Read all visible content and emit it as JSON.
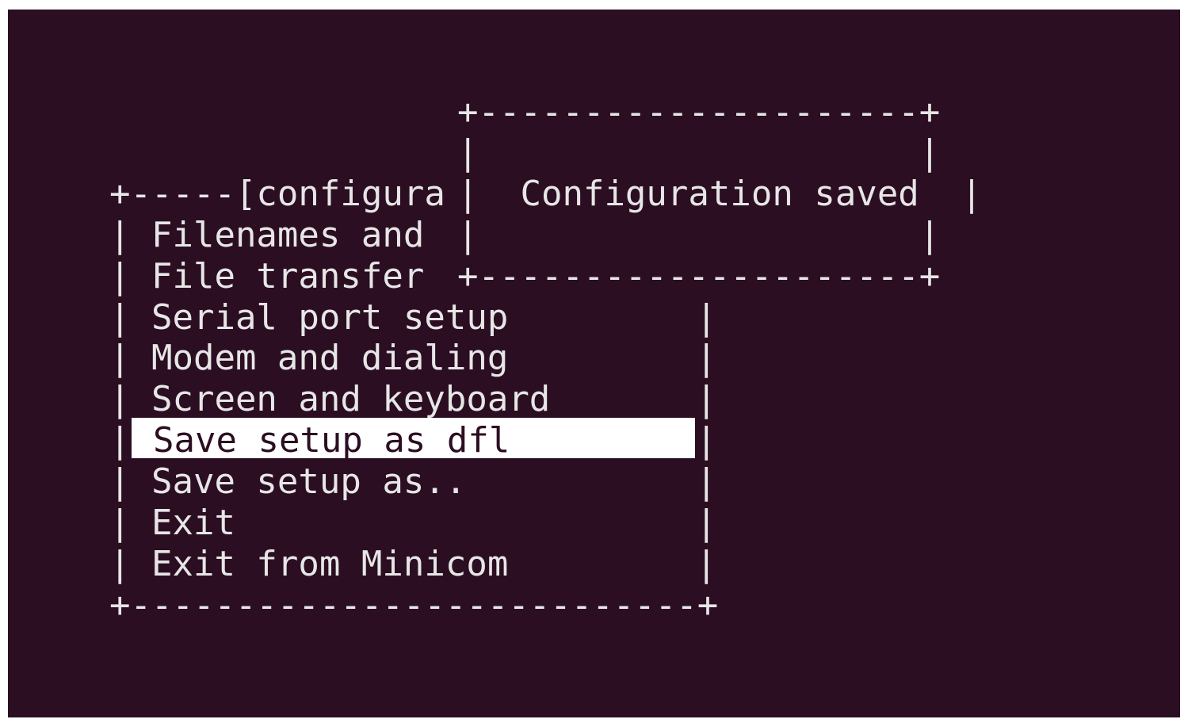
{
  "terminal": {
    "rows": [
      "",
      "",
      "            +---------------------+",
      "            |                     |",
      "+-----[configura|  Configuration saved  |",
      "| Filenames and |                     |",
      "| File transfer +---------------------+",
      "| Serial port setup        |",
      "| Modem and dialing        |",
      "| Screen and keyboard      |",
      "|",
      "| Save setup as..          |",
      "| Exit                     |",
      "| Exit from Minicom        |",
      "+--------------------------+"
    ]
  },
  "menu": {
    "title_fragment": "+-----[configura",
    "items": [
      {
        "label": "Filenames and"
      },
      {
        "label": "File transfer"
      },
      {
        "label": "Serial port setup"
      },
      {
        "label": "Modem and dialing"
      },
      {
        "label": "Screen and keyboard"
      },
      {
        "label": "Save setup as dfl",
        "selected": true
      },
      {
        "label": "Save setup as.."
      },
      {
        "label": "Exit"
      },
      {
        "label": "Exit from Minicom"
      }
    ],
    "bottom_border": "+----------------------------+"
  },
  "dialog": {
    "top_border": "+---------------------+",
    "message": "Configuration saved",
    "bottom_border": "+---------------------+"
  },
  "colors": {
    "background": "#2c0e22",
    "text": "#e6e6e6",
    "highlight": "#ffffff"
  }
}
